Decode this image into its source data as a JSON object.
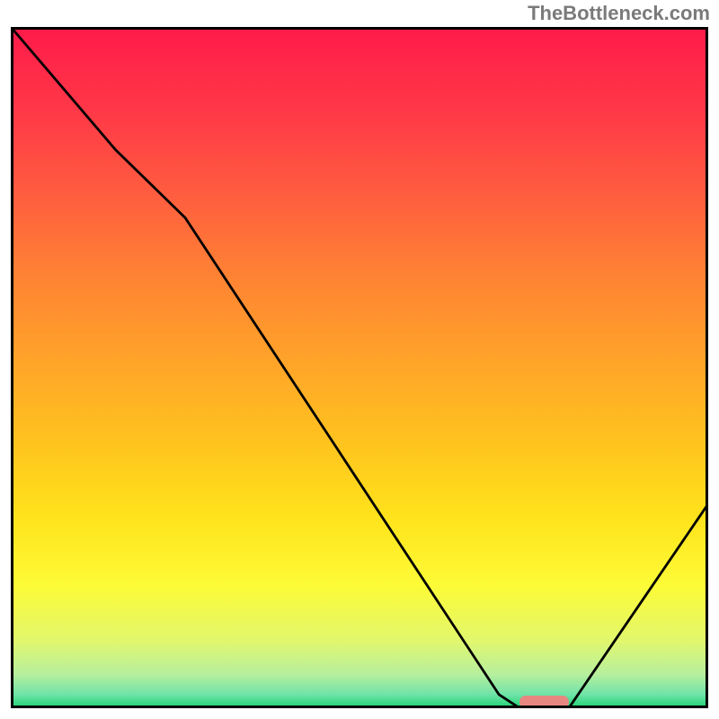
{
  "watermark": "TheBottleneck.com",
  "chart_data": {
    "type": "line",
    "title": "",
    "xlabel": "",
    "ylabel": "",
    "xlim": [
      0,
      100
    ],
    "ylim": [
      0,
      100
    ],
    "grid": false,
    "legend": false,
    "background": "red-green-gradient",
    "series": [
      {
        "name": "bottleneck-curve",
        "x": [
          0,
          15,
          25,
          70,
          73,
          80,
          100
        ],
        "values": [
          100,
          82,
          72,
          2,
          0,
          0,
          30
        ]
      }
    ],
    "marker": {
      "name": "optimal-range",
      "x_range": [
        73,
        80
      ],
      "y": 0,
      "color": "#e8877f"
    },
    "gradient_stops": [
      {
        "pos": 0,
        "color": "#ff1a4a"
      },
      {
        "pos": 13,
        "color": "#ff3a47"
      },
      {
        "pos": 25,
        "color": "#ff5e3f"
      },
      {
        "pos": 37,
        "color": "#ff8433"
      },
      {
        "pos": 50,
        "color": "#ffa628"
      },
      {
        "pos": 62,
        "color": "#ffc61e"
      },
      {
        "pos": 72,
        "color": "#ffe31b"
      },
      {
        "pos": 82,
        "color": "#fdfb37"
      },
      {
        "pos": 90,
        "color": "#e2f76c"
      },
      {
        "pos": 95,
        "color": "#b7ef9d"
      },
      {
        "pos": 98,
        "color": "#6fe3a8"
      },
      {
        "pos": 100,
        "color": "#1cd471"
      }
    ]
  }
}
